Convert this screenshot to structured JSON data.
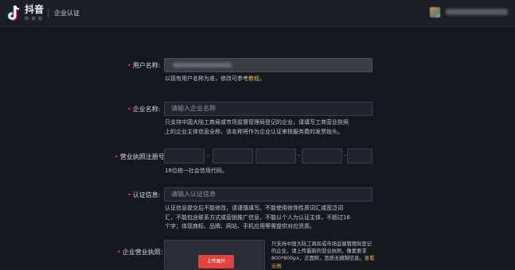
{
  "header": {
    "app_name": "抖音",
    "app_subtitle": "商 家 版",
    "page_title": "企业认证"
  },
  "form": {
    "username": {
      "label": "用户名称:",
      "hint_text": "以现有用户名称为准，修改可参考",
      "hint_link": "教程",
      "hint_end": "。"
    },
    "company_name": {
      "label": "企业名称:",
      "placeholder": "请输入企业名称",
      "hint_lines": [
        "只支持中国大陆工商局或市场监督管理局登记的企业，请填写工商营业执照",
        "上的企业主体信息全称，该名称将作为企业认证审核服务费的发票抬头。"
      ]
    },
    "license_number": {
      "label": "营业执照注册号:",
      "separator": "-",
      "hint": "18位统一社会信用代码。"
    },
    "certification_info": {
      "label": "认证信息:",
      "placeholder": "请输入认证信息",
      "hint_lines": [
        "认证信息提交后不能修改，请谨慎填写。不能使用修饰性质词汇或宽泛词",
        "汇，不能包含联系方式或营销推广信息，不能以个人为认证主体，不超过16",
        "个字；体现商标、品牌、网站、手机应用等需提供对应资质。"
      ]
    },
    "business_license": {
      "label": "企业营业执照:",
      "upload_label": "上传图片",
      "hint_lines": [
        "只支持中国大陆工商局或市场监督管理局登记",
        "的企业，请上传最新的营业执照，像素要求",
        "800*800px，正面照，宽质无模糊信息。"
      ],
      "hint_link": "查看",
      "hint_link_tail": "示例"
    }
  }
}
